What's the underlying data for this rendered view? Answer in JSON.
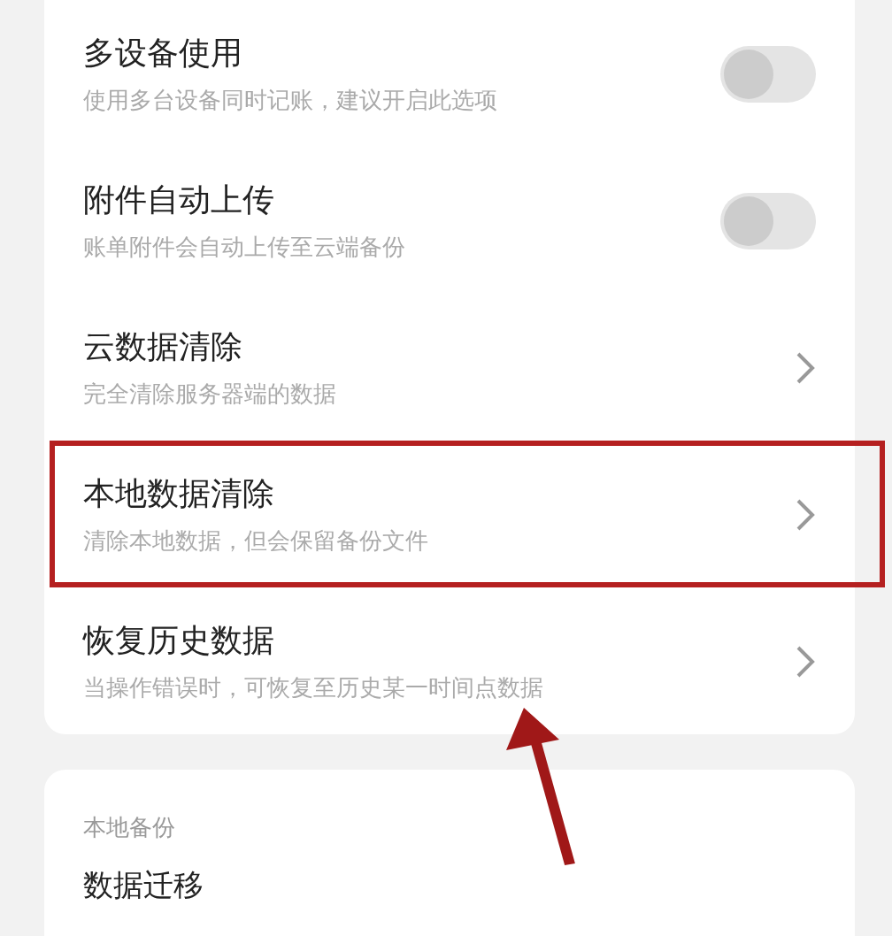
{
  "settings": [
    {
      "kind": "toggle",
      "title": "多设备使用",
      "subtitle": "使用多台设备同时记账，建议开启此选项",
      "on": false,
      "highlighted": false
    },
    {
      "kind": "toggle",
      "title": "附件自动上传",
      "subtitle": "账单附件会自动上传至云端备份",
      "on": false,
      "highlighted": false
    },
    {
      "kind": "link",
      "title": "云数据清除",
      "subtitle": "完全清除服务器端的数据",
      "highlighted": false
    },
    {
      "kind": "link",
      "title": "本地数据清除",
      "subtitle": "清除本地数据，但会保留备份文件",
      "highlighted": true
    },
    {
      "kind": "link",
      "title": "恢复历史数据",
      "subtitle": "当操作错误时，可恢复至历史某一时间点数据",
      "highlighted": false
    }
  ],
  "local_backup": {
    "header": "本地备份",
    "items": [
      {
        "title": "数据迁移"
      }
    ]
  }
}
